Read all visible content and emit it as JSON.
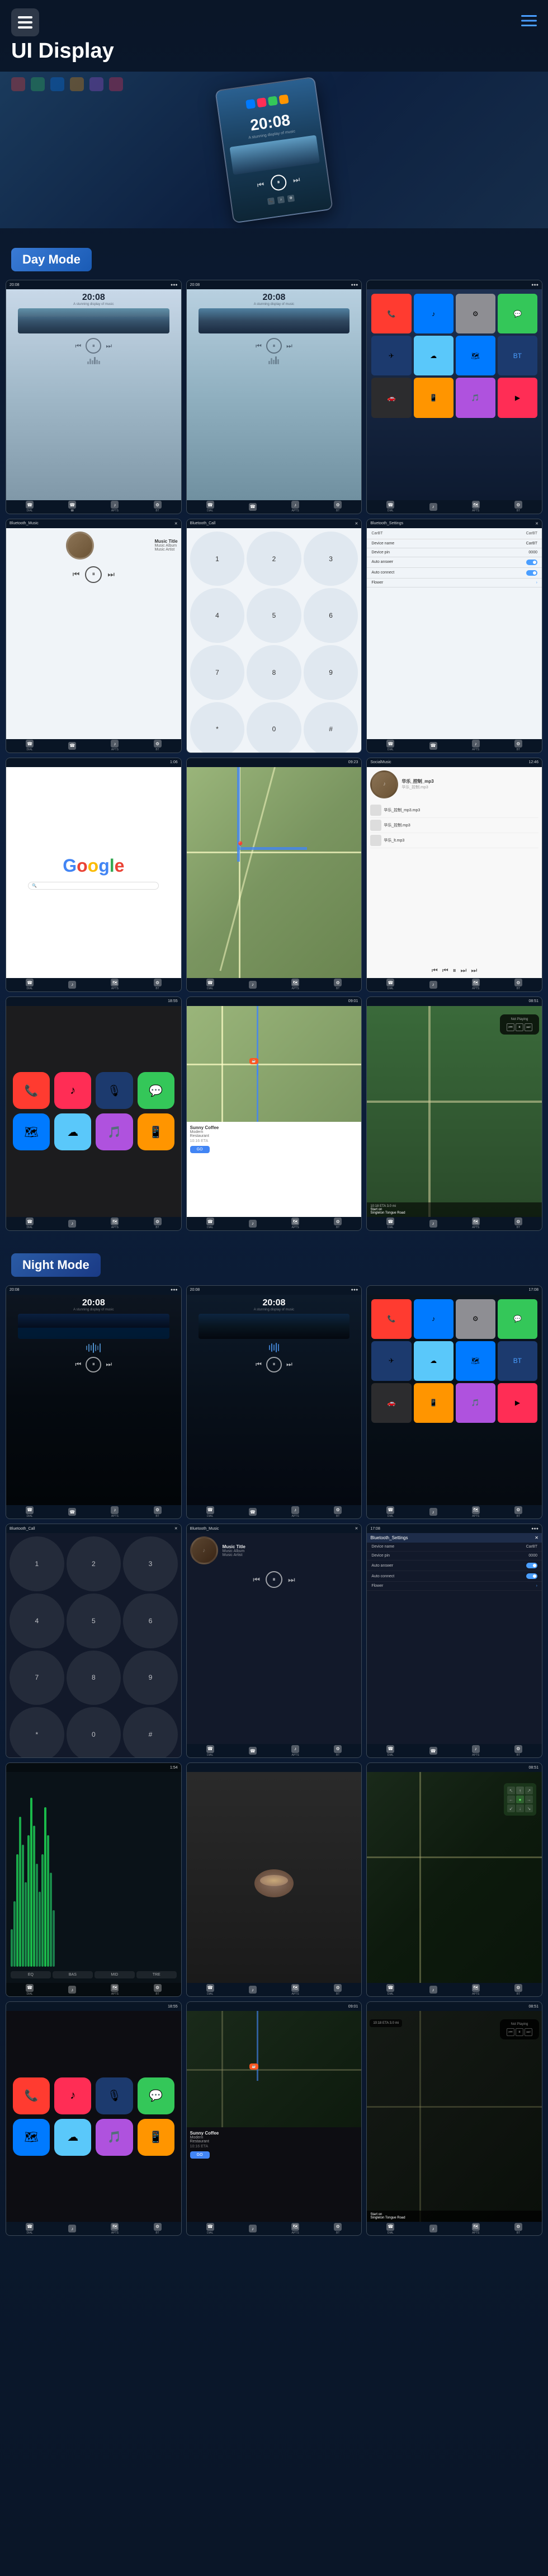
{
  "header": {
    "title": "UI Display",
    "menu_icon": "☰",
    "action_icon": "≡"
  },
  "sections": {
    "day_mode": "Day Mode",
    "night_mode": "Night Mode"
  },
  "screens": {
    "time": "20:08",
    "subtitle": "A stunning display of music",
    "music_title": "Music Title",
    "music_album": "Music Album",
    "music_artist": "Music Artist",
    "track_name": "华乐_控制_mp3",
    "google_text": "Google",
    "not_playing": "Not Playing",
    "start_on": "Start on",
    "navigation": "Singleton\nTongue Road",
    "eta": "10:18 ETA  3.0 mi",
    "restaurant": "Sunny Coffee\nModern\nRestaurant",
    "go": "GO",
    "device_name": "CarBT",
    "device_pin": "0000",
    "auto_answer": "Auto answer",
    "auto_connect": "Auto connect",
    "flower": "Flower"
  },
  "nav_items": [
    "DIAL",
    "☎",
    "APTS",
    "BT"
  ],
  "app_colors": {
    "phone": "#FF3B30",
    "messages": "#34C759",
    "maps": "#007AFF",
    "music": "#FF2D55",
    "settings": "#8E8E93",
    "photos": "#FFCC00"
  }
}
